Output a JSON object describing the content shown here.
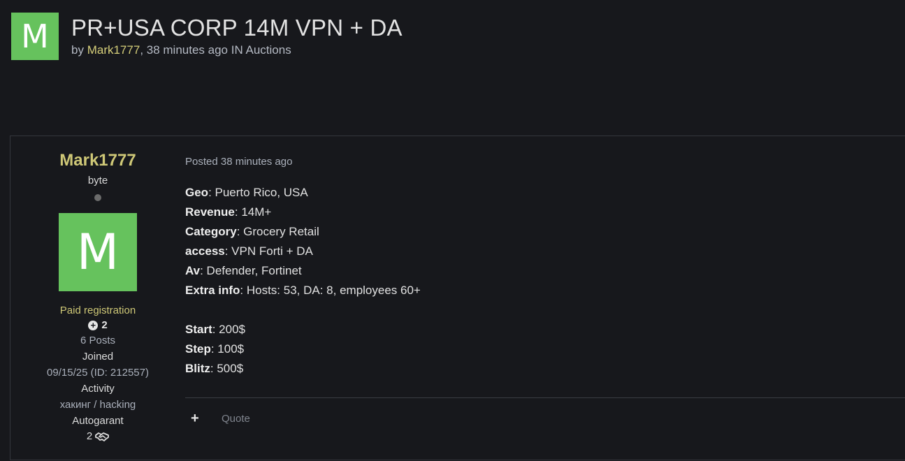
{
  "topic": {
    "avatar_letter": "M",
    "title": "PR+USA CORP 14M VPN + DA",
    "by_label": "by",
    "author": "Mark1777",
    "meta_rest": ", 38 minutes ago IN Auctions"
  },
  "author_panel": {
    "name": "Mark1777",
    "rank": "byte",
    "avatar_letter": "M",
    "group": "Paid registration",
    "reputation": "2",
    "posts": "6 Posts",
    "joined_label": "Joined",
    "joined_value": "09/15/25 (ID: 212557)",
    "activity_label": "Activity",
    "activity_value": "хакинг / hacking",
    "autogarant_label": "Autogarant",
    "autogarant_value": "2"
  },
  "post": {
    "posted_label": "Posted",
    "posted_time": "38 minutes ago",
    "fields": [
      {
        "label": "Geo",
        "value": ":  Puerto Rico, USA"
      },
      {
        "label": "Revenue",
        "value": ": 14M+"
      },
      {
        "label": "Category",
        "value": ": Grocery Retail"
      },
      {
        "label": "access",
        "value": ": VPN Forti + DA"
      },
      {
        "label": "Av",
        "value": ": Defender, Fortinet"
      },
      {
        "label": "Extra info",
        "value": ": Hosts: 53, DA: 8, employees 60+"
      }
    ],
    "auction": [
      {
        "label": "Start",
        "value": ": 200$"
      },
      {
        "label": "Step",
        "value": ": 100$"
      },
      {
        "label": "Blitz",
        "value": ": 500$"
      }
    ],
    "actions": {
      "plus_icon": "plus-icon",
      "quote_label": "Quote"
    }
  },
  "colors": {
    "background": "#17181c",
    "avatar_green": "#66c25d",
    "username_yellow": "#cfc877"
  }
}
